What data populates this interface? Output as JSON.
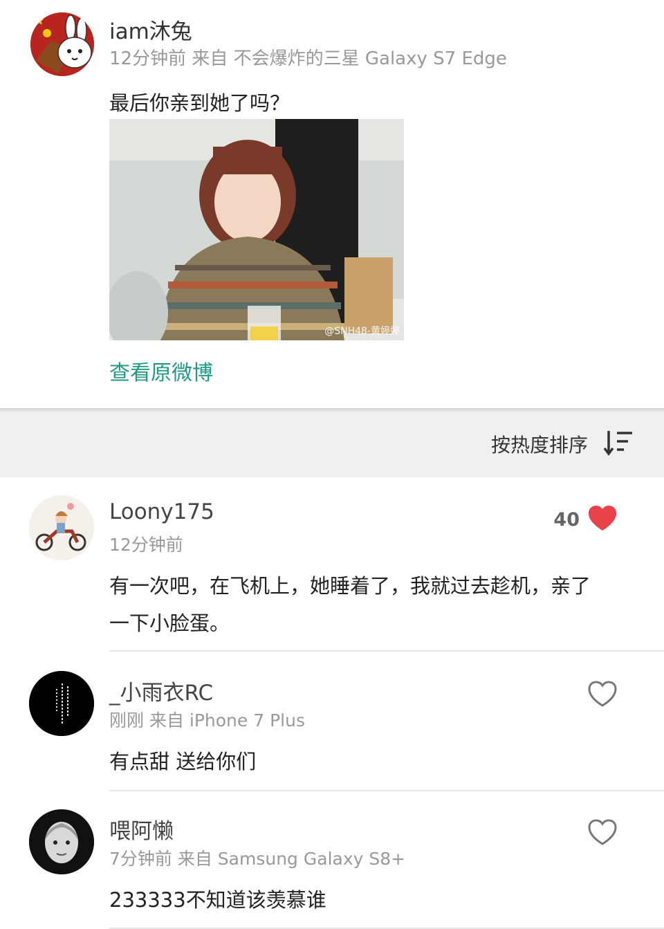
{
  "post": {
    "username": "iam沐兔",
    "meta": "12分钟前 来自 不会爆炸的三星 Galaxy S7 Edge",
    "text": "最后你亲到她了吗？",
    "photo_watermark": "@SNH48-黄婷婷",
    "link_label": "查看原微博"
  },
  "sort": {
    "label": "按热度排序",
    "icon": "sort-descending-icon"
  },
  "comments": [
    {
      "name": "Loony175",
      "meta": "12分钟前",
      "text": "有一次吧，在飞机上，她睡着了，我就过去趁机，亲了一下小脸蛋。",
      "likes": "40",
      "liked": true
    },
    {
      "name": "_小雨衣RC",
      "meta": "刚刚 来自 iPhone 7 Plus",
      "text": "有点甜 送给你们",
      "likes": "",
      "liked": false
    },
    {
      "name": "喂阿懒",
      "meta": "7分钟前 来自 Samsung Galaxy S8+",
      "text": "233333不知道该羡慕谁",
      "likes": "",
      "liked": false
    }
  ],
  "colors": {
    "link": "#1f9a86",
    "heart_liked": "#e8434b",
    "heart_outline": "#777777",
    "sortbar_bg": "#f0f0f0"
  }
}
